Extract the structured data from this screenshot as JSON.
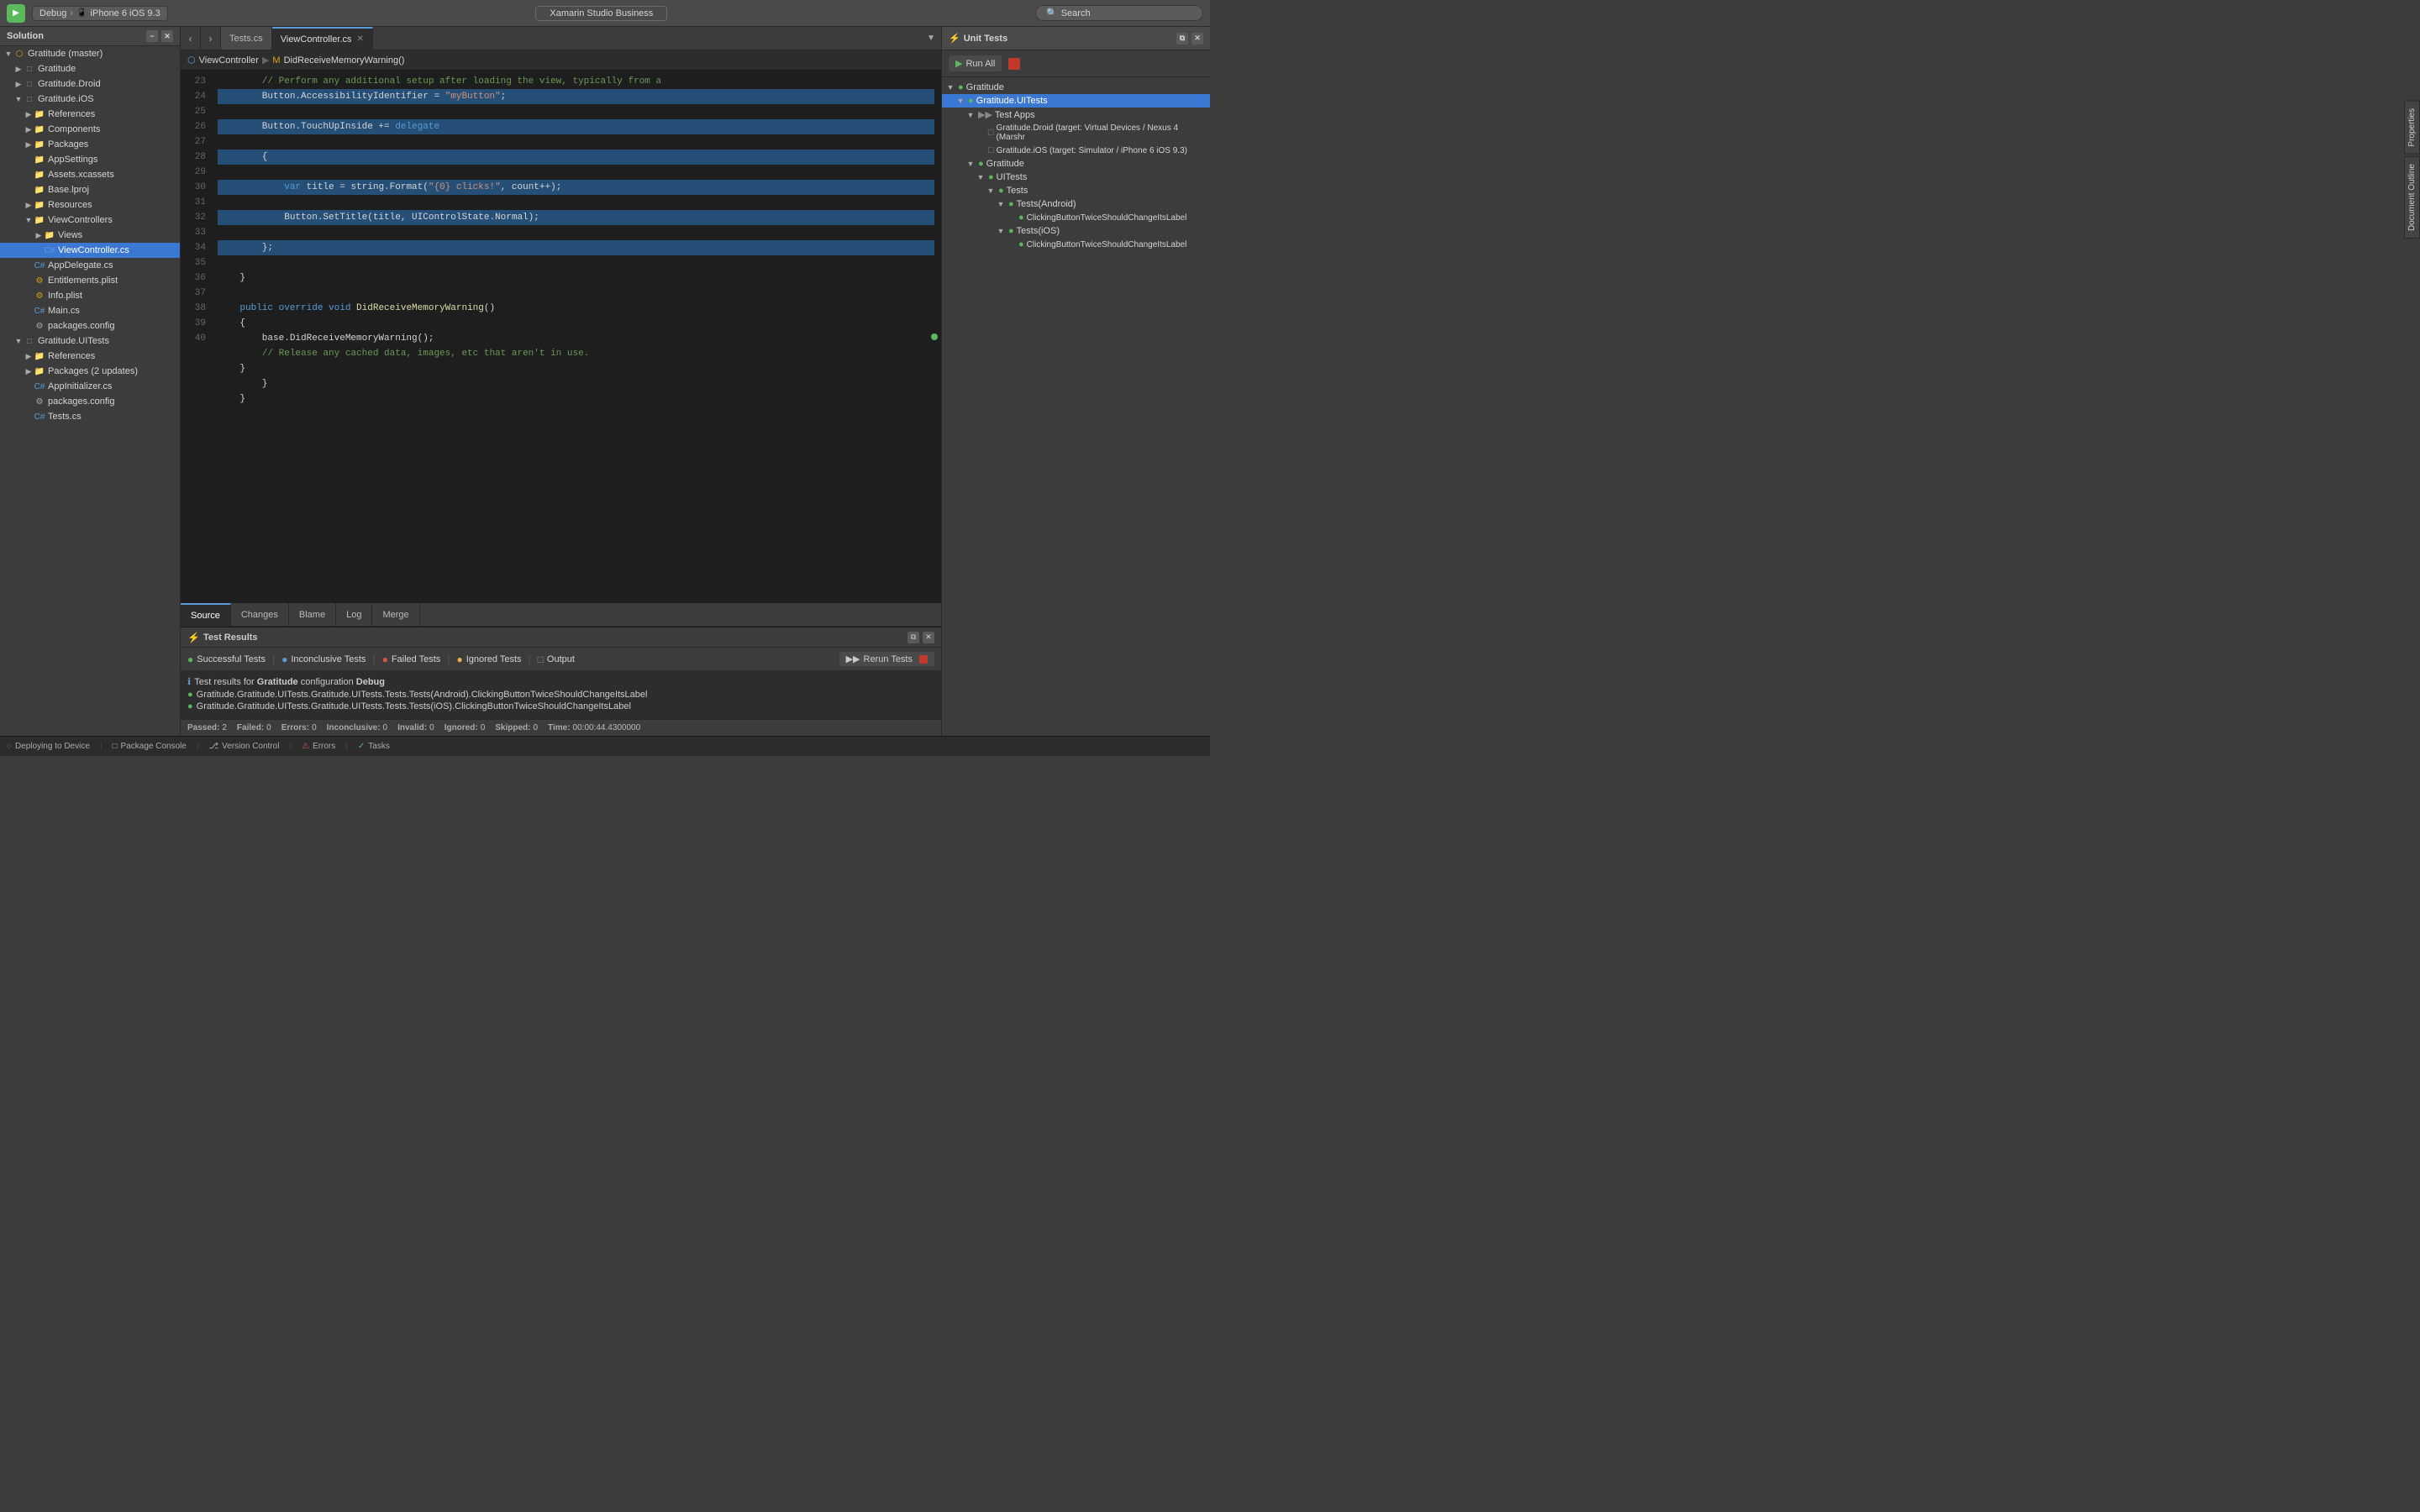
{
  "topbar": {
    "play_label": "▶",
    "config": "Debug",
    "device": "iPhone 6 iOS 9.3",
    "app_title": "Xamarin Studio Business",
    "search_placeholder": "Search"
  },
  "sidebar": {
    "title": "Solution",
    "items": [
      {
        "id": "solution-root",
        "label": "Gratitude (master)",
        "level": 0,
        "expanded": true,
        "type": "solution"
      },
      {
        "id": "gratitude-proj",
        "label": "Gratitude",
        "level": 1,
        "expanded": false,
        "type": "project"
      },
      {
        "id": "gratitude-droid",
        "label": "Gratitude.Droid",
        "level": 1,
        "expanded": false,
        "type": "project"
      },
      {
        "id": "gratitude-ios",
        "label": "Gratitude.iOS",
        "level": 1,
        "expanded": true,
        "type": "project"
      },
      {
        "id": "ios-references",
        "label": "References",
        "level": 2,
        "expanded": false,
        "type": "folder"
      },
      {
        "id": "ios-components",
        "label": "Components",
        "level": 2,
        "expanded": false,
        "type": "folder"
      },
      {
        "id": "ios-packages",
        "label": "Packages",
        "level": 2,
        "expanded": false,
        "type": "folder"
      },
      {
        "id": "ios-appsettings",
        "label": "AppSettings",
        "level": 2,
        "expanded": false,
        "type": "folder"
      },
      {
        "id": "ios-assets",
        "label": "Assets.xcassets",
        "level": 2,
        "expanded": false,
        "type": "folder"
      },
      {
        "id": "ios-baseproj",
        "label": "Base.lproj",
        "level": 2,
        "expanded": false,
        "type": "folder"
      },
      {
        "id": "ios-resources",
        "label": "Resources",
        "level": 2,
        "expanded": false,
        "type": "folder"
      },
      {
        "id": "ios-viewcontrollers",
        "label": "ViewControllers",
        "level": 2,
        "expanded": true,
        "type": "folder"
      },
      {
        "id": "ios-views",
        "label": "Views",
        "level": 3,
        "expanded": false,
        "type": "folder"
      },
      {
        "id": "viewcontroller-cs",
        "label": "ViewController.cs",
        "level": 3,
        "expanded": false,
        "type": "cs",
        "selected": true
      },
      {
        "id": "appdelegate-cs",
        "label": "AppDelegate.cs",
        "level": 2,
        "expanded": false,
        "type": "cs"
      },
      {
        "id": "entitlements-plist",
        "label": "Entitlements.plist",
        "level": 2,
        "expanded": false,
        "type": "plist"
      },
      {
        "id": "info-plist",
        "label": "Info.plist",
        "level": 2,
        "expanded": false,
        "type": "plist"
      },
      {
        "id": "main-cs",
        "label": "Main.cs",
        "level": 2,
        "expanded": false,
        "type": "cs"
      },
      {
        "id": "packages-config",
        "label": "packages.config",
        "level": 2,
        "expanded": false,
        "type": "file"
      },
      {
        "id": "gratitude-uitests",
        "label": "Gratitude.UITests",
        "level": 1,
        "expanded": true,
        "type": "project"
      },
      {
        "id": "uitests-references",
        "label": "References",
        "level": 2,
        "expanded": false,
        "type": "folder"
      },
      {
        "id": "uitests-packages",
        "label": "Packages (2 updates)",
        "level": 2,
        "expanded": false,
        "type": "folder"
      },
      {
        "id": "appinitializer-cs",
        "label": "AppInitializer.cs",
        "level": 2,
        "expanded": false,
        "type": "cs"
      },
      {
        "id": "uitests-packages-config",
        "label": "packages.config",
        "level": 2,
        "expanded": false,
        "type": "file"
      },
      {
        "id": "tests-cs",
        "label": "Tests.cs",
        "level": 2,
        "expanded": false,
        "type": "cs"
      }
    ]
  },
  "tabs": {
    "items": [
      {
        "id": "tests-tab",
        "label": "Tests.cs",
        "active": false,
        "closable": false
      },
      {
        "id": "viewcontroller-tab",
        "label": "ViewController.cs",
        "active": true,
        "closable": true
      }
    ]
  },
  "breadcrumb": {
    "items": [
      "ViewController",
      "DidReceiveMemoryWarning()"
    ]
  },
  "code": {
    "lines": [
      {
        "num": 23,
        "text": "        // Perform any additional setup after loading the view, typically from a",
        "highlight": false
      },
      {
        "num": 24,
        "text": "        Button.AccessibilityIdentifier = \"myButton\";",
        "highlight": true
      },
      {
        "num": 25,
        "text": "        Button.TouchUpInside += delegate",
        "highlight": true
      },
      {
        "num": 26,
        "text": "        {",
        "highlight": true
      },
      {
        "num": 27,
        "text": "            var title = string.Format(\"{0} clicks!\", count++);",
        "highlight": true
      },
      {
        "num": 28,
        "text": "            Button.SetTitle(title, UIControlState.Normal);",
        "highlight": true
      },
      {
        "num": 29,
        "text": "        };",
        "highlight": true
      },
      {
        "num": 30,
        "text": "    }",
        "highlight": false
      },
      {
        "num": 31,
        "text": "",
        "highlight": false
      },
      {
        "num": 32,
        "text": "",
        "highlight": false
      },
      {
        "num": 33,
        "text": "    public override void DidReceiveMemoryWarning()",
        "highlight": false
      },
      {
        "num": 34,
        "text": "    {",
        "highlight": false
      },
      {
        "num": 35,
        "text": "        base.DidReceiveMemoryWarning();",
        "highlight": false
      },
      {
        "num": 36,
        "text": "        // Release any cached data, images, etc that aren't in use.",
        "highlight": false
      },
      {
        "num": 37,
        "text": "    }",
        "highlight": false
      },
      {
        "num": 38,
        "text": "        }",
        "highlight": false
      },
      {
        "num": 39,
        "text": "    }",
        "highlight": false
      },
      {
        "num": 40,
        "text": "",
        "highlight": false
      }
    ]
  },
  "source_tabs": [
    "Source",
    "Changes",
    "Blame",
    "Log",
    "Merge"
  ],
  "test_results": {
    "title": "Test Results",
    "filters": [
      {
        "id": "successful",
        "label": "Successful Tests",
        "color": "green",
        "symbol": "●"
      },
      {
        "id": "inconclusive",
        "label": "Inconclusive Tests",
        "color": "blue",
        "symbol": "●"
      },
      {
        "id": "failed",
        "label": "Failed Tests",
        "color": "red",
        "symbol": "●"
      },
      {
        "id": "ignored",
        "label": "Ignored Tests",
        "color": "yellow",
        "symbol": "●"
      },
      {
        "id": "output",
        "label": "Output",
        "color": "gray",
        "symbol": "□"
      },
      {
        "id": "rerun",
        "label": "Rerun Tests",
        "color": "green",
        "symbol": "▶▶"
      }
    ],
    "info_line": "Test results for Gratitude configuration Debug",
    "results": [
      {
        "status": "pass",
        "text": "Gratitude.Gratitude.UITests.Gratitude.UITests.Tests.Tests(Android).ClickingButtonTwiceShouldChangeItsLabel"
      },
      {
        "status": "pass",
        "text": "Gratitude.Gratitude.UITests.Gratitude.UITests.Tests.Tests(iOS).ClickingButtonTwiceShouldChangeItsLabel"
      }
    ],
    "status_bar": {
      "passed": "2",
      "failed": "0",
      "errors": "0",
      "inconclusive": "0",
      "invalid": "0",
      "ignored": "0",
      "skipped": "0",
      "time": "00:00:44.4300000"
    }
  },
  "unit_tests": {
    "title": "Unit Tests",
    "run_all_label": "Run All",
    "tree": [
      {
        "id": "ut-gratitude",
        "label": "Gratitude",
        "level": 0,
        "expanded": true,
        "status": "green"
      },
      {
        "id": "ut-gratitude-uitests",
        "label": "Gratitude.UITests",
        "level": 1,
        "expanded": true,
        "status": "green",
        "selected": true
      },
      {
        "id": "ut-test-apps",
        "label": "Test Apps",
        "level": 2,
        "expanded": true,
        "status": "gray"
      },
      {
        "id": "ut-droid",
        "label": "Gratitude.Droid (target: Virtual Devices / Nexus 4 (Marshr",
        "level": 3,
        "status": "gray"
      },
      {
        "id": "ut-ios-target",
        "label": "Gratitude.iOS (target: Simulator / iPhone 6 iOS 9.3)",
        "level": 3,
        "status": "gray"
      },
      {
        "id": "ut-gratitude2",
        "label": "Gratitude",
        "level": 2,
        "expanded": true,
        "status": "green"
      },
      {
        "id": "ut-uitests",
        "label": "UITests",
        "level": 3,
        "expanded": true,
        "status": "green"
      },
      {
        "id": "ut-tests",
        "label": "Tests",
        "level": 4,
        "expanded": true,
        "status": "green"
      },
      {
        "id": "ut-android-tests",
        "label": "Tests(Android)",
        "level": 5,
        "expanded": true,
        "status": "green"
      },
      {
        "id": "ut-clicking-android",
        "label": "ClickingButtonTwiceShouldChangeItsLabel",
        "level": 6,
        "status": "green"
      },
      {
        "id": "ut-ios-tests",
        "label": "Tests(iOS)",
        "level": 5,
        "expanded": true,
        "status": "green"
      },
      {
        "id": "ut-clicking-ios",
        "label": "ClickingButtonTwiceShouldChangeItsLabel",
        "level": 6,
        "status": "green"
      }
    ]
  },
  "bottom_bar": {
    "deploying": "Deploying to Device",
    "package_console": "Package Console",
    "version_control": "Version Control",
    "errors": "Errors",
    "tasks": "Tasks"
  }
}
